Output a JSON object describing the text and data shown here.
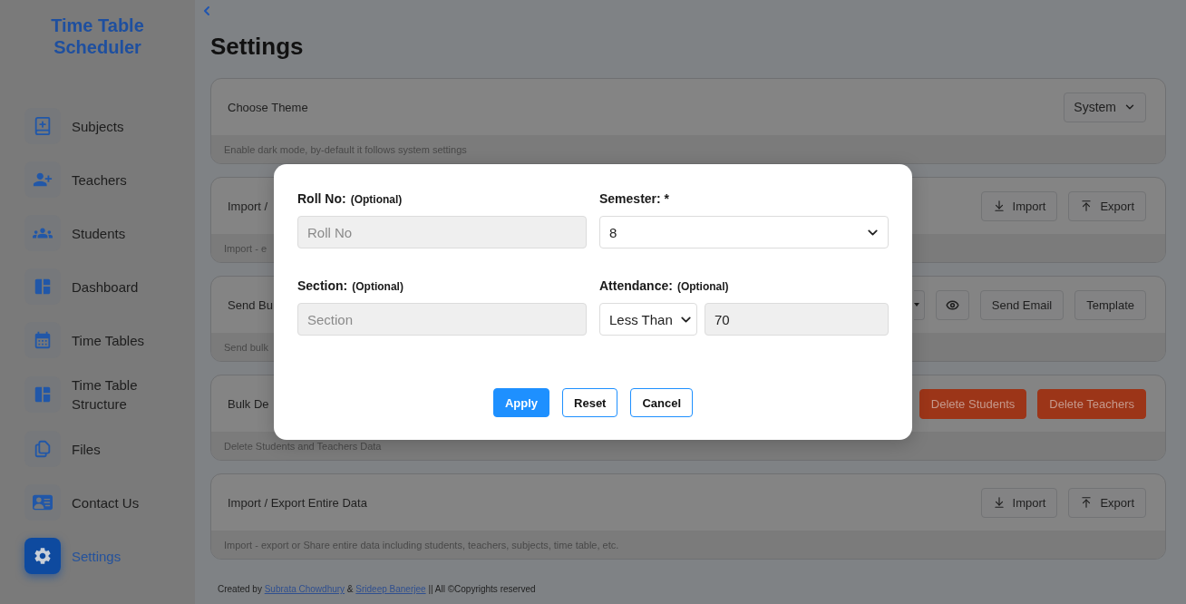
{
  "sidebar": {
    "title": "Time Table Scheduler",
    "items": [
      {
        "label": "Subjects",
        "kind": "subjects",
        "selected": false
      },
      {
        "label": "Teachers",
        "kind": "teachers",
        "selected": false
      },
      {
        "label": "Students",
        "kind": "students",
        "selected": false
      },
      {
        "label": "Dashboard",
        "kind": "dashboard",
        "selected": false
      },
      {
        "label": "Time Tables",
        "kind": "timetables",
        "selected": false
      },
      {
        "label": "Time Table Structure",
        "kind": "structure",
        "selected": false
      },
      {
        "label": "Files",
        "kind": "files",
        "selected": false
      },
      {
        "label": "Contact Us",
        "kind": "contact",
        "selected": false
      },
      {
        "label": "Settings",
        "kind": "settings",
        "selected": true
      }
    ]
  },
  "page": {
    "title": "Settings"
  },
  "cards": [
    {
      "title": "Choose Theme",
      "description": "Enable dark mode, by-default it follows system settings",
      "controls": [
        {
          "kind": "select",
          "label": "System"
        }
      ]
    },
    {
      "title": "Import /",
      "description": "Import - e",
      "controls": [
        {
          "kind": "import",
          "label": "Import"
        },
        {
          "kind": "export",
          "label": "Export"
        }
      ]
    },
    {
      "title": "Send Bu",
      "description": "Send bulk",
      "controls": [
        {
          "kind": "dropdown"
        },
        {
          "kind": "view"
        },
        {
          "kind": "button",
          "label": "Send Email"
        },
        {
          "kind": "button",
          "label": "Template"
        }
      ]
    },
    {
      "title": "Bulk De",
      "description": "Delete Students and Teachers Data",
      "controls": [
        {
          "kind": "danger",
          "label": "Delete Students"
        },
        {
          "kind": "danger",
          "label": "Delete Teachers"
        }
      ]
    },
    {
      "title": "Import / Export Entire Data",
      "description": "Import - export or Share entire data including students, teachers, subjects, time table, etc.",
      "controls": [
        {
          "kind": "import",
          "label": "Import"
        },
        {
          "kind": "export",
          "label": "Export"
        }
      ]
    }
  ],
  "footer": {
    "parts": [
      {
        "kind": "text",
        "text": "Created by "
      },
      {
        "kind": "link",
        "text": "Subrata Chowdhury"
      },
      {
        "kind": "text",
        "text": " & "
      },
      {
        "kind": "link",
        "text": "Srideep Banerjee"
      },
      {
        "kind": "text",
        "text": " || All ©Copyrights reserved"
      }
    ]
  },
  "filter_dialog": {
    "fields": [
      {
        "kind": "text",
        "label": "Roll No:",
        "hint": "(Optional)",
        "placeholder": "Roll No"
      },
      {
        "kind": "select",
        "label": "Semester: *",
        "value": "8"
      },
      {
        "kind": "text",
        "label": "Section:",
        "hint": "(Optional)",
        "placeholder": "Section"
      },
      {
        "kind": "range",
        "label": "Attendance:",
        "hint": "(Optional)",
        "operator": "Less Than",
        "value": "70"
      }
    ],
    "buttons": [
      {
        "kind": "primary",
        "label": "Apply"
      },
      {
        "kind": "outline",
        "label": "Reset"
      },
      {
        "kind": "outline",
        "label": "Cancel"
      }
    ]
  }
}
